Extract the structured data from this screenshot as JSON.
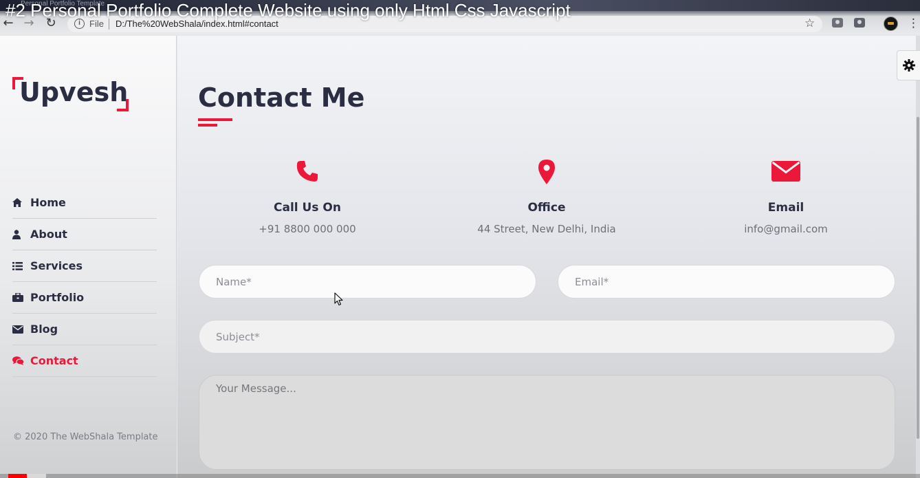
{
  "video": {
    "title": "#2 Personal Portfolio Complete Website using only Html Css Javascript"
  },
  "browser": {
    "tab_title": "Personal Portfolio Template",
    "scheme": "File",
    "url": "D:/The%20WebShala/index.html#contact"
  },
  "sidebar": {
    "logo": "Upvesh",
    "nav": [
      {
        "label": "Home",
        "icon": "home-icon"
      },
      {
        "label": "About",
        "icon": "user-icon"
      },
      {
        "label": "Services",
        "icon": "list-icon"
      },
      {
        "label": "Portfolio",
        "icon": "briefcase-icon"
      },
      {
        "label": "Blog",
        "icon": "envelope-icon"
      },
      {
        "label": "Contact",
        "icon": "comments-icon",
        "active": true
      }
    ],
    "copyright": "© 2020 The WebShala Template"
  },
  "contact": {
    "title": "Contact Me",
    "items": [
      {
        "icon": "phone-icon",
        "heading": "Call Us On",
        "text": "+91 8800 000 000"
      },
      {
        "icon": "map-marker-icon",
        "heading": "Office",
        "text": "44 Street, New Delhi, India"
      },
      {
        "icon": "envelope-icon",
        "heading": "Email",
        "text": "info@gmail.com"
      }
    ],
    "form": {
      "name_placeholder": "Name*",
      "email_placeholder": "Email*",
      "subject_placeholder": "Subject*",
      "message_placeholder": "Your Message..."
    }
  },
  "colors": {
    "accent": "#ec1839",
    "text_dark": "#2b2d42",
    "text_muted": "#6e6f76"
  }
}
